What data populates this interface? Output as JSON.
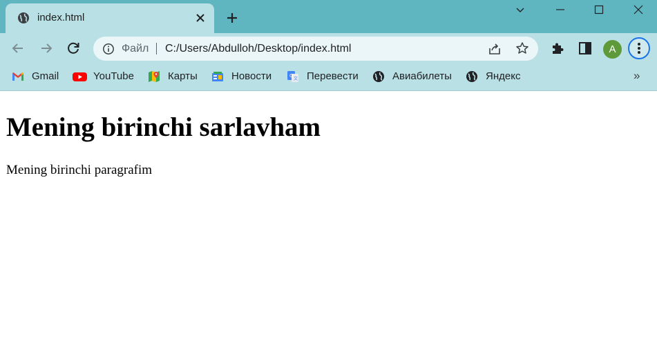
{
  "tab": {
    "title": "index.html",
    "favicon": "globe-icon",
    "close_icon": "close-icon",
    "new_tab_icon": "plus-icon"
  },
  "window_controls": [
    "chevron-down-icon",
    "minimize-icon",
    "maximize-icon",
    "close-icon"
  ],
  "toolbar": {
    "back_icon": "arrow-left-icon",
    "forward_icon": "arrow-right-icon",
    "reload_icon": "reload-icon",
    "omnibox": {
      "info_icon": "info-icon",
      "scheme_label": "Файл",
      "url": "C:/Users/Abdulloh/Desktop/index.html",
      "share_icon": "share-icon",
      "star_icon": "star-icon"
    },
    "extensions_icon": "puzzle-icon",
    "side_panel_icon": "side-panel-icon",
    "avatar_letter": "A",
    "menu_icon": "kebab-menu-icon"
  },
  "bookmarks": [
    {
      "label": "Gmail",
      "icon": "gmail-icon"
    },
    {
      "label": "YouTube",
      "icon": "youtube-icon"
    },
    {
      "label": "Карты",
      "icon": "maps-icon"
    },
    {
      "label": "Новости",
      "icon": "news-icon"
    },
    {
      "label": "Перевести",
      "icon": "translate-icon"
    },
    {
      "label": "Авиабилеты",
      "icon": "globe-icon"
    },
    {
      "label": "Яндекс",
      "icon": "globe-icon"
    }
  ],
  "bookmarks_more": "»",
  "page": {
    "heading": "Mening birinchi sarlavham",
    "paragraph": "Mening birinchi paragrafim"
  },
  "colors": {
    "tab_strip": "#5fb6c1",
    "toolbar": "#b9e0e5",
    "omnibox": "#eaf6f7",
    "avatar": "#5f9a3a",
    "menu_ring": "#1a73e8"
  }
}
